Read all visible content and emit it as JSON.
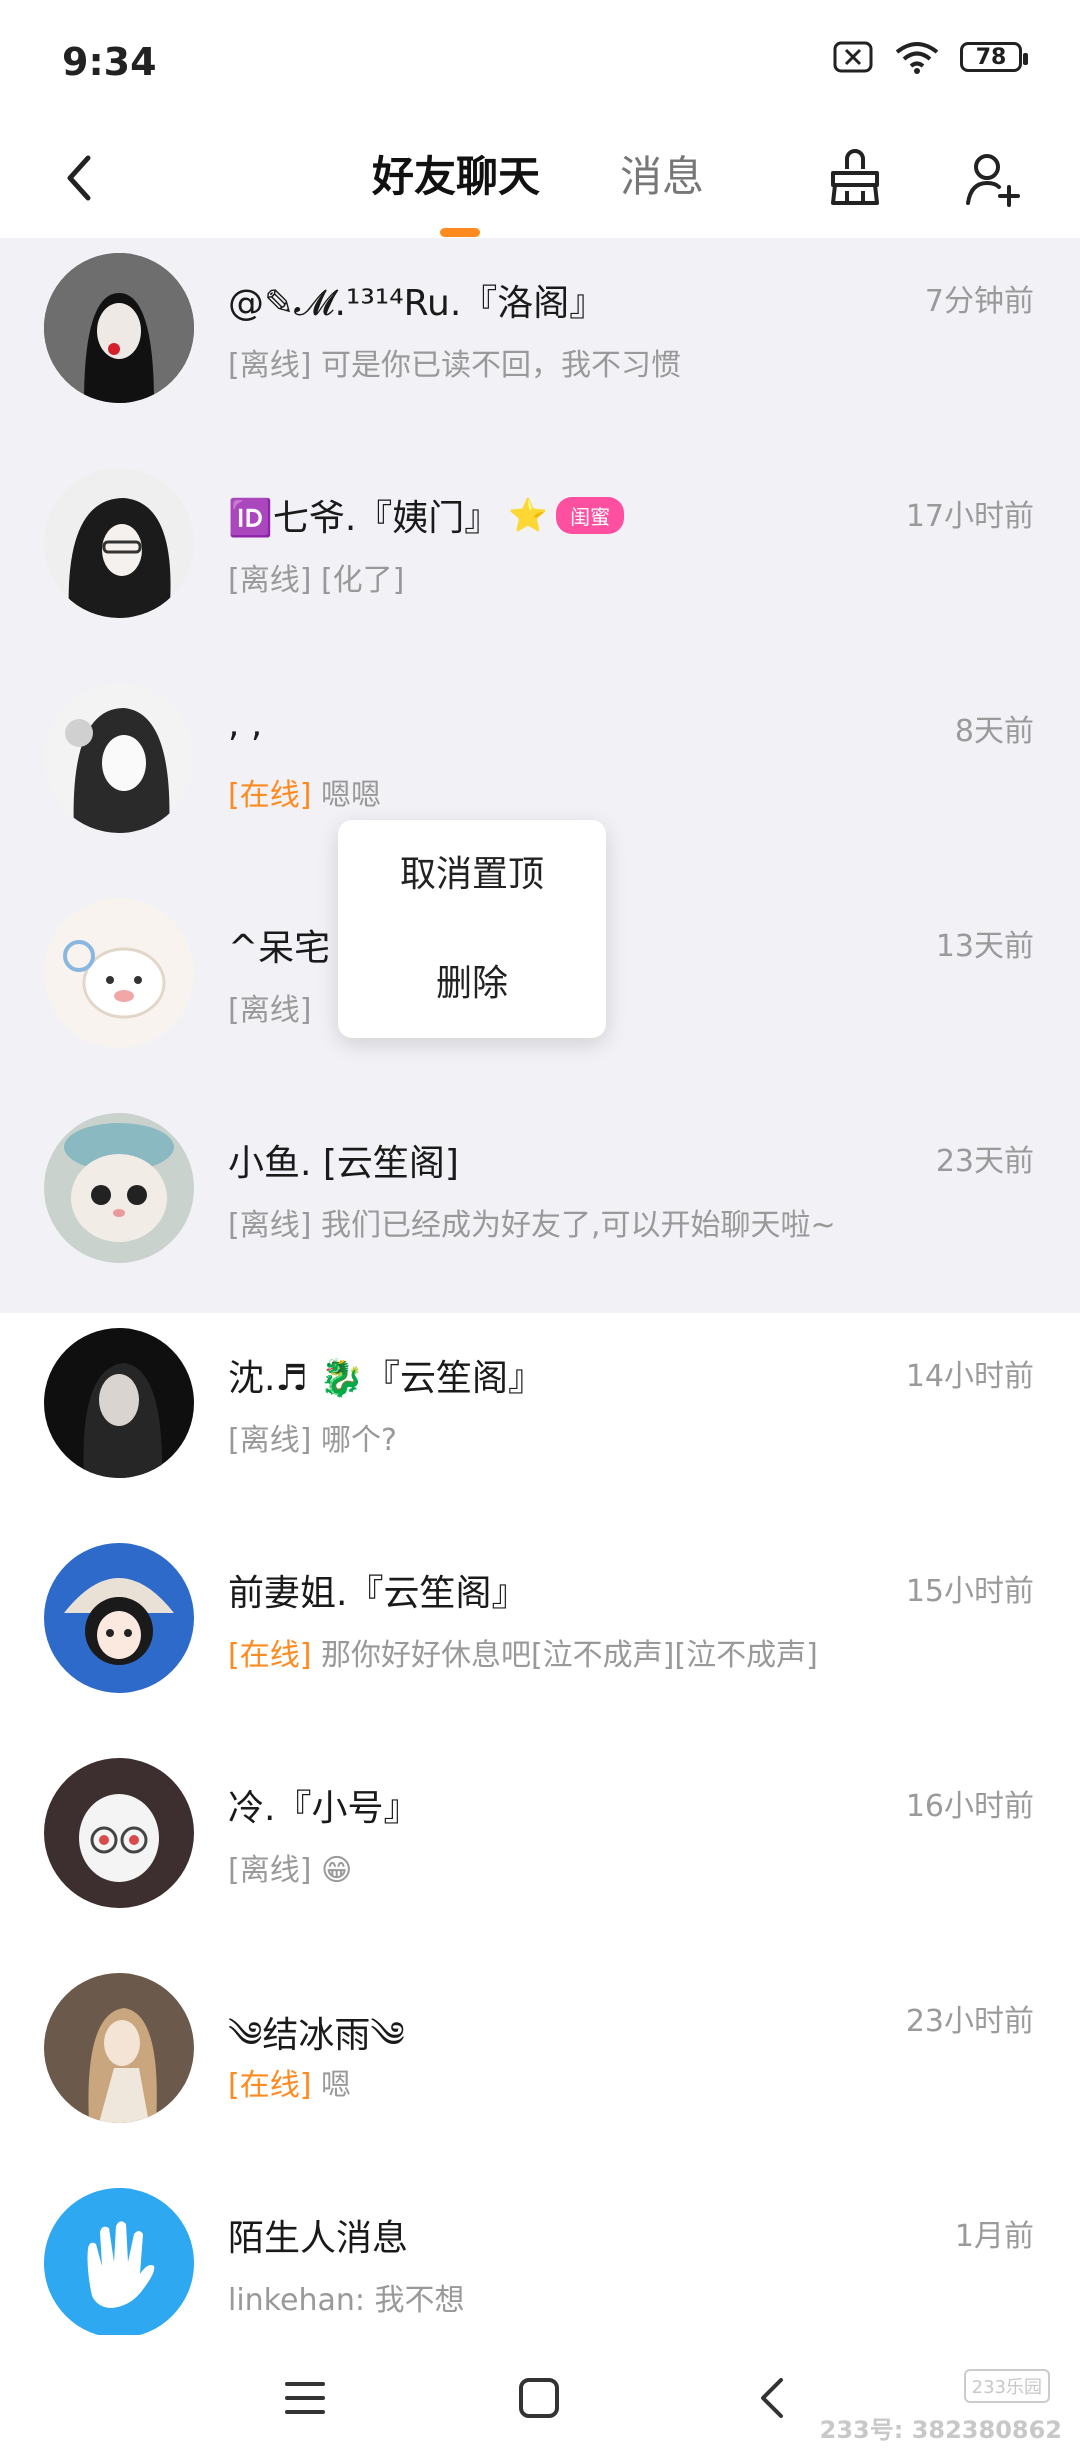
{
  "status_bar": {
    "time": "9:34",
    "battery": "78"
  },
  "header": {
    "tab_friends": "好友聊天",
    "tab_messages": "消息"
  },
  "context_menu": {
    "unpin": "取消置顶",
    "delete": "删除"
  },
  "chats": [
    {
      "name": "@✎𝓜.¹³¹⁴Ru.『洛阁』",
      "time": "7分钟前",
      "status": "[离线]",
      "status_type": "offline",
      "message": "可是你已读不回，我不习惯",
      "pinned": true,
      "avatar_color": "#3a3a3a"
    },
    {
      "name": "🆔七爷.『姨门』",
      "badge": "闺蜜",
      "time": "17小时前",
      "status": "[离线]",
      "status_type": "offline",
      "message": "[化了]",
      "pinned": true,
      "avatar_color": "#555555"
    },
    {
      "name": ", ,",
      "time": "8天前",
      "status": "[在线]",
      "status_type": "online",
      "message": "嗯嗯",
      "pinned": true,
      "avatar_color": "#bdbdbd"
    },
    {
      "name": "^呆宅",
      "time": "13天前",
      "status": "[离线]",
      "status_type": "offline",
      "message": "",
      "pinned": true,
      "avatar_color": "#f3e7da"
    },
    {
      "name": "小鱼. [云笙阁]",
      "time": "23天前",
      "status": "[离线]",
      "status_type": "offline",
      "message": "我们已经成为好友了,可以开始聊天啦~",
      "pinned": true,
      "avatar_color": "#8fa4a3"
    },
    {
      "name": "沈.♬ 🐉『云笙阁』",
      "time": "14小时前",
      "status": "[离线]",
      "status_type": "offline",
      "message": "哪个?",
      "pinned": false,
      "avatar_color": "#1c1c1c"
    },
    {
      "name": "前妻姐.『云笙阁』",
      "time": "15小时前",
      "status": "[在线]",
      "status_type": "online",
      "message": "那你好好休息吧[泣不成声][泣不成声]",
      "pinned": false,
      "avatar_color": "#2d6ac9"
    },
    {
      "name": "冷.『小号』",
      "time": "16小时前",
      "status": "[离线]",
      "status_type": "offline",
      "message": "😁",
      "pinned": false,
      "avatar_color": "#4a4142"
    },
    {
      "name": "༄结冰雨༄",
      "time": "23小时前",
      "status": "[在线]",
      "status_type": "online",
      "message": "嗯",
      "pinned": false,
      "avatar_color": "#7a6a5c"
    },
    {
      "name": "陌生人消息",
      "time": "1月前",
      "status": "",
      "status_type": "none",
      "message": "linkehan: 我不想",
      "pinned": false,
      "avatar_color": "#2ea8f0"
    }
  ],
  "watermark": {
    "logo": "233乐园",
    "id_text": "233号: 382380862"
  }
}
